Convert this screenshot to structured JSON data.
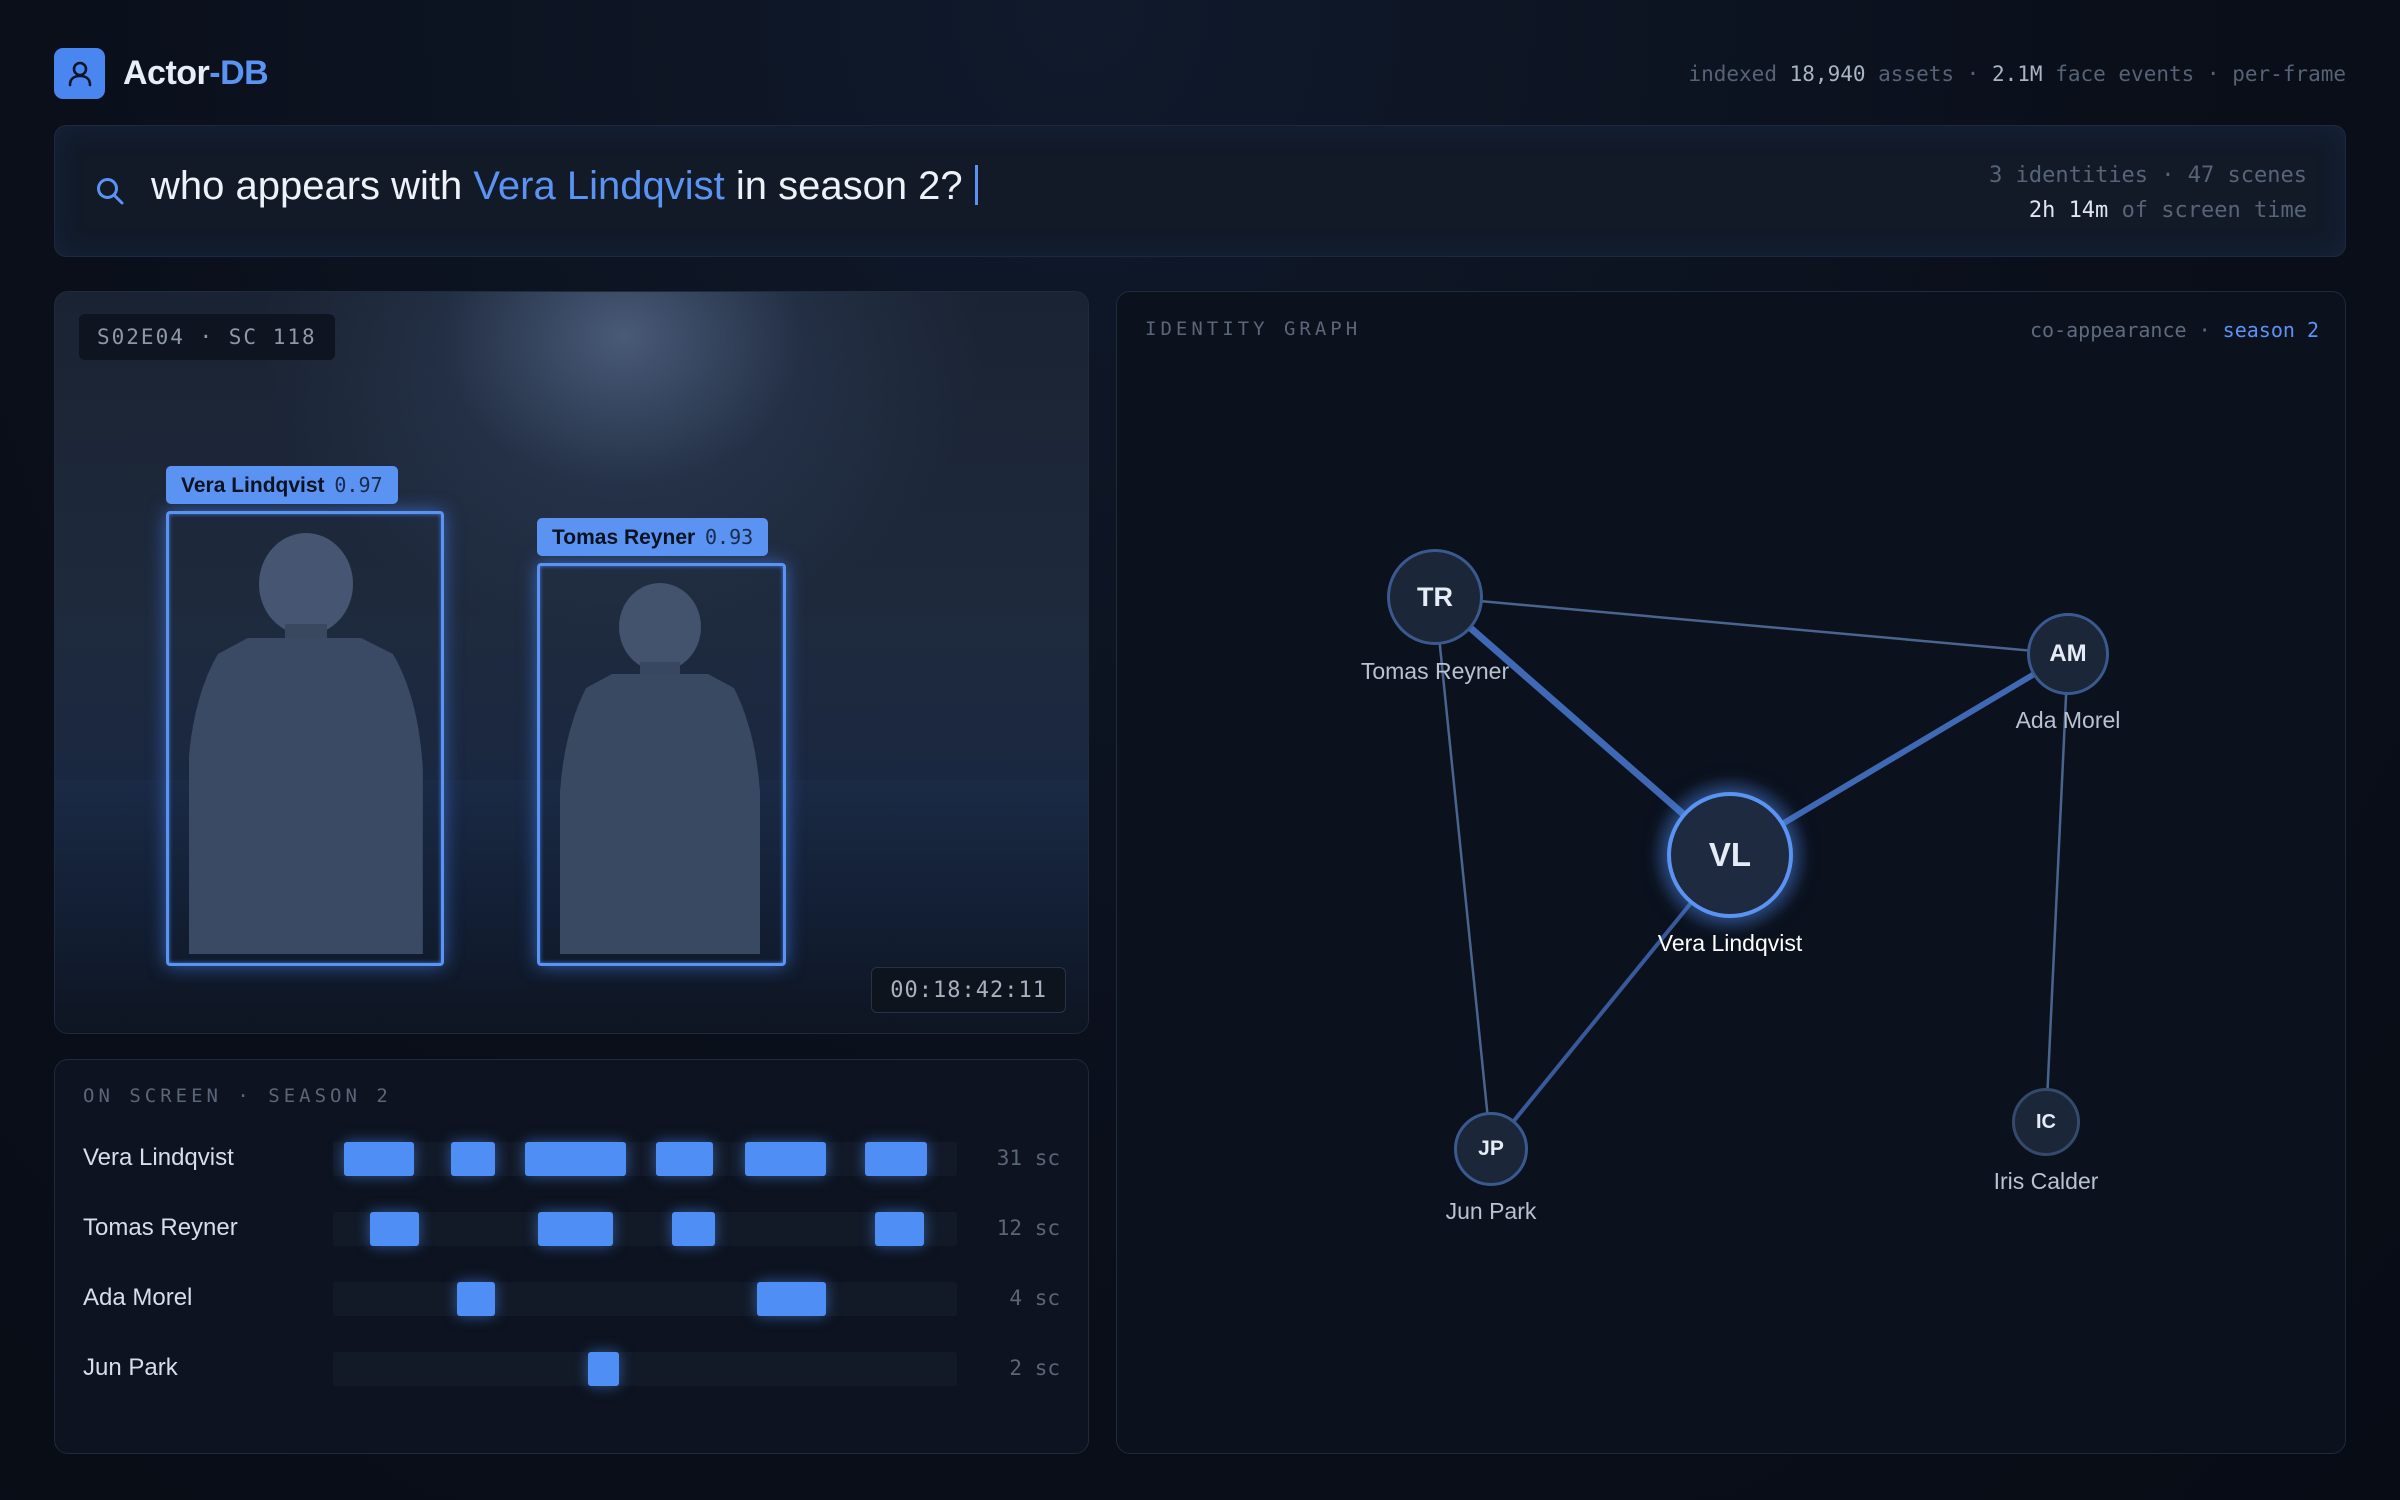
{
  "app": {
    "name_part1": "Actor",
    "name_part2": "-DB",
    "stats": {
      "prefix": "indexed",
      "assets_count": "18,940",
      "assets_label": "assets ·",
      "events_count": "2.1M",
      "events_label": "face events · per-frame"
    }
  },
  "search": {
    "query_before": "who appears with",
    "query_name": "Vera Lindqvist",
    "query_after": "in season 2?",
    "meta_line1": "3 identities · 47 scenes",
    "screen_time_value": "2h 14m",
    "screen_time_label": "of screen time"
  },
  "video": {
    "scene_chip": "S02E04 · SC 118",
    "timecode": "00:18:42:11",
    "detections": [
      {
        "name": "Vera Lindqvist",
        "confidence": "0.97"
      },
      {
        "name": "Tomas Reyner",
        "confidence": "0.93"
      }
    ]
  },
  "onscreen": {
    "title": "ON SCREEN · SEASON 2",
    "rows": [
      {
        "name": "Vera Lindqvist",
        "count": "31 sc"
      },
      {
        "name": "Tomas Reyner",
        "count": "12 sc"
      },
      {
        "name": "Ada Morel",
        "count": "4 sc"
      },
      {
        "name": "Jun Park",
        "count": "2 sc"
      }
    ]
  },
  "graph": {
    "title": "IDENTITY GRAPH",
    "meta_prefix": "co-appearance ·",
    "meta_season": "season 2",
    "nodes": [
      {
        "id": "VL",
        "initials": "VL",
        "name": "Vera Lindqvist"
      },
      {
        "id": "TR",
        "initials": "TR",
        "name": "Tomas Reyner"
      },
      {
        "id": "AM",
        "initials": "AM",
        "name": "Ada Morel"
      },
      {
        "id": "JP",
        "initials": "JP",
        "name": "Jun Park"
      },
      {
        "id": "IC",
        "initials": "IC",
        "name": "Iris Calder"
      }
    ]
  },
  "colors": {
    "accent": "#5b93f3",
    "segment": "#4f8ef5",
    "background": "#0a0f1a"
  },
  "icons": {
    "logo": "person-icon",
    "search": "search-icon"
  }
}
